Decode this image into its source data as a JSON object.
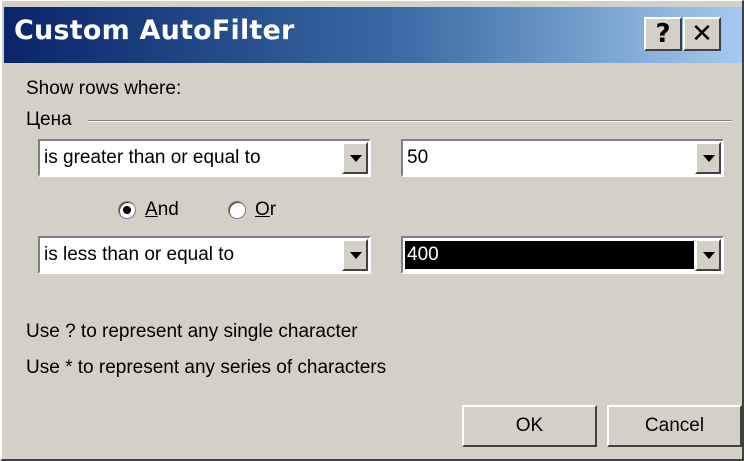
{
  "window": {
    "title": "Custom AutoFilter",
    "help_label": "?",
    "close_label": "✕"
  },
  "dialog": {
    "prompt": "Show rows where:",
    "field_name": "Цена",
    "criteria1": {
      "operator": "is greater than or equal to",
      "value": "50"
    },
    "logic": {
      "and_label": "And",
      "or_label": "Or",
      "selected": "And"
    },
    "criteria2": {
      "operator": "is less than or equal to",
      "value": "400"
    },
    "hint_single": "Use ? to represent any single character",
    "hint_series": "Use * to represent any series of characters"
  },
  "buttons": {
    "ok": "OK",
    "cancel": "Cancel"
  },
  "colors": {
    "title_gradient_start": "#0a246a",
    "title_gradient_end": "#a6caf0",
    "dialog_face": "#d4d0c8",
    "selection": "#000000"
  }
}
